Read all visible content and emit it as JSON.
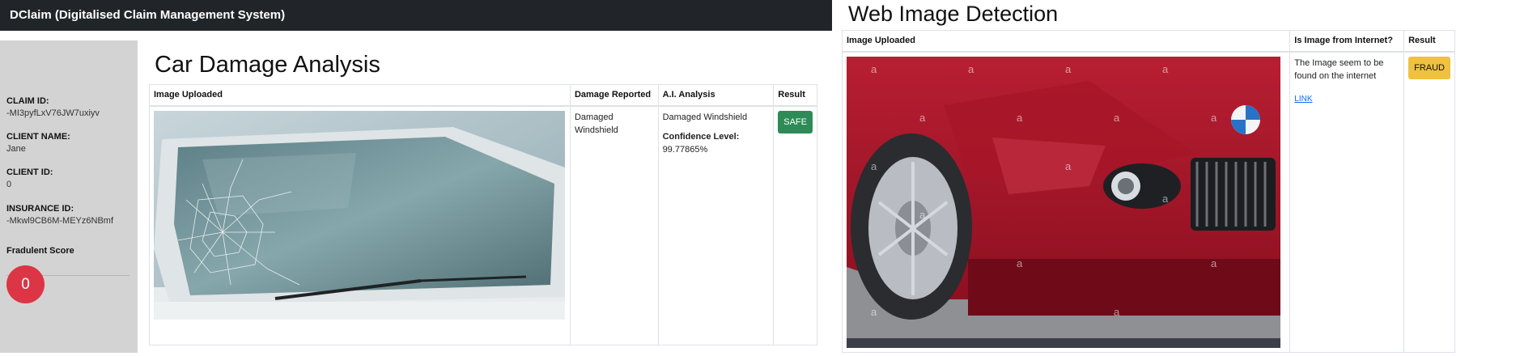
{
  "navbar": {
    "brand": "DClaim (Digitalised Claim Management System)"
  },
  "sidebar": {
    "claim_id_label": "CLAIM ID:",
    "claim_id_value": "-MI3pyfLxV76JW7uxiyv",
    "client_name_label": "CLIENT NAME:",
    "client_name_value": "Jane",
    "client_id_label": "CLIENT ID:",
    "client_id_value": "0",
    "insurance_id_label": "INSURANCE ID:",
    "insurance_id_value": "-Mkwl9CB6M-MEYz6NBmf",
    "fraud_score_label": "Fradulent Score",
    "fraud_score_value": "0"
  },
  "analysis": {
    "title": "Car Damage Analysis",
    "headers": [
      "Image Uploaded",
      "Damage Reported",
      "A.I. Analysis",
      "Result"
    ],
    "damage_reported": "Damaged Windshield",
    "ai_analysis": "Damaged Windshield",
    "confidence_label": "Confidence Level:",
    "confidence_value": "99.77865%",
    "result": "SAFE"
  },
  "web_detection": {
    "title": "Web Image Detection",
    "headers": [
      "Image Uploaded",
      "Is Image from Internet?",
      "Result"
    ],
    "message": "The Image seem to be found on the internet",
    "link": "LINK",
    "result": "FRAUD"
  },
  "colors": {
    "navbar": "#212529",
    "sidebar": "#d3d3d3",
    "score": "#dc3545",
    "safe": "#2e8b57",
    "fraud": "#f0c040"
  }
}
